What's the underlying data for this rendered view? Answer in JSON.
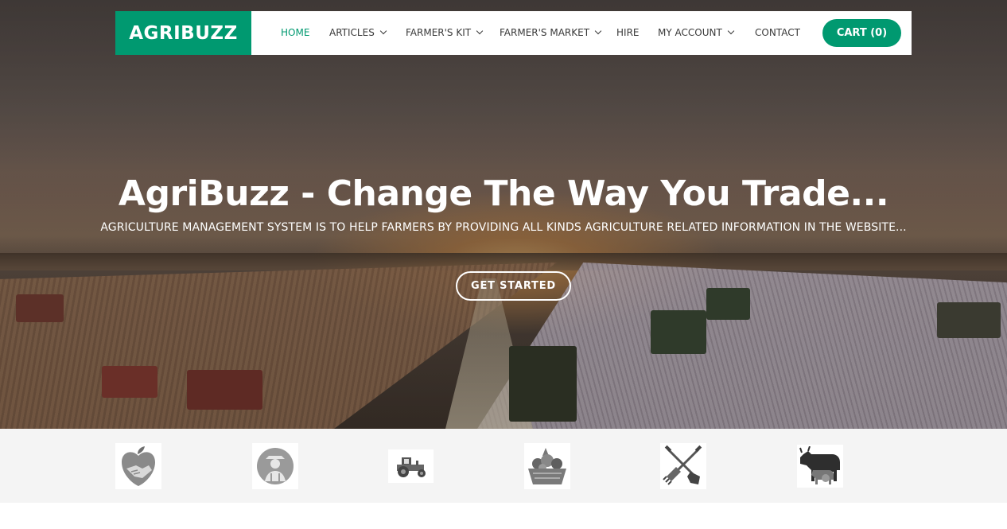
{
  "brand": {
    "name": "AGRIBUZZ",
    "color": "#009970"
  },
  "nav": {
    "items": [
      {
        "label": "HOME",
        "active": true,
        "dropdown": false
      },
      {
        "label": "ARTICLES",
        "active": false,
        "dropdown": true
      },
      {
        "label": "FARMER'S KIT",
        "active": false,
        "dropdown": true
      },
      {
        "label": "FARMER'S MARKET",
        "active": false,
        "dropdown": true
      },
      {
        "label": "HIRE",
        "active": false,
        "dropdown": false
      },
      {
        "label": "MY ACCOUNT",
        "active": false,
        "dropdown": true
      },
      {
        "label": "CONTACT",
        "active": false,
        "dropdown": false
      }
    ],
    "cart_label": "CART (0)"
  },
  "hero": {
    "title": "AgriBuzz - Change The Way You Trade...",
    "subtitle": "AGRICULTURE MANAGEMENT SYSTEM IS TO HELP FARMERS BY PROVIDING ALL KINDS AGRICULTURE RELATED INFORMATION IN THE WEBSITE...",
    "cta_label": "GET STARTED"
  },
  "feature_icons": [
    {
      "icon": "handshake-apple-icon"
    },
    {
      "icon": "farmer-icon"
    },
    {
      "icon": "tractor-icon"
    },
    {
      "icon": "produce-basket-icon"
    },
    {
      "icon": "shovel-rake-icon"
    },
    {
      "icon": "livestock-icon"
    }
  ]
}
